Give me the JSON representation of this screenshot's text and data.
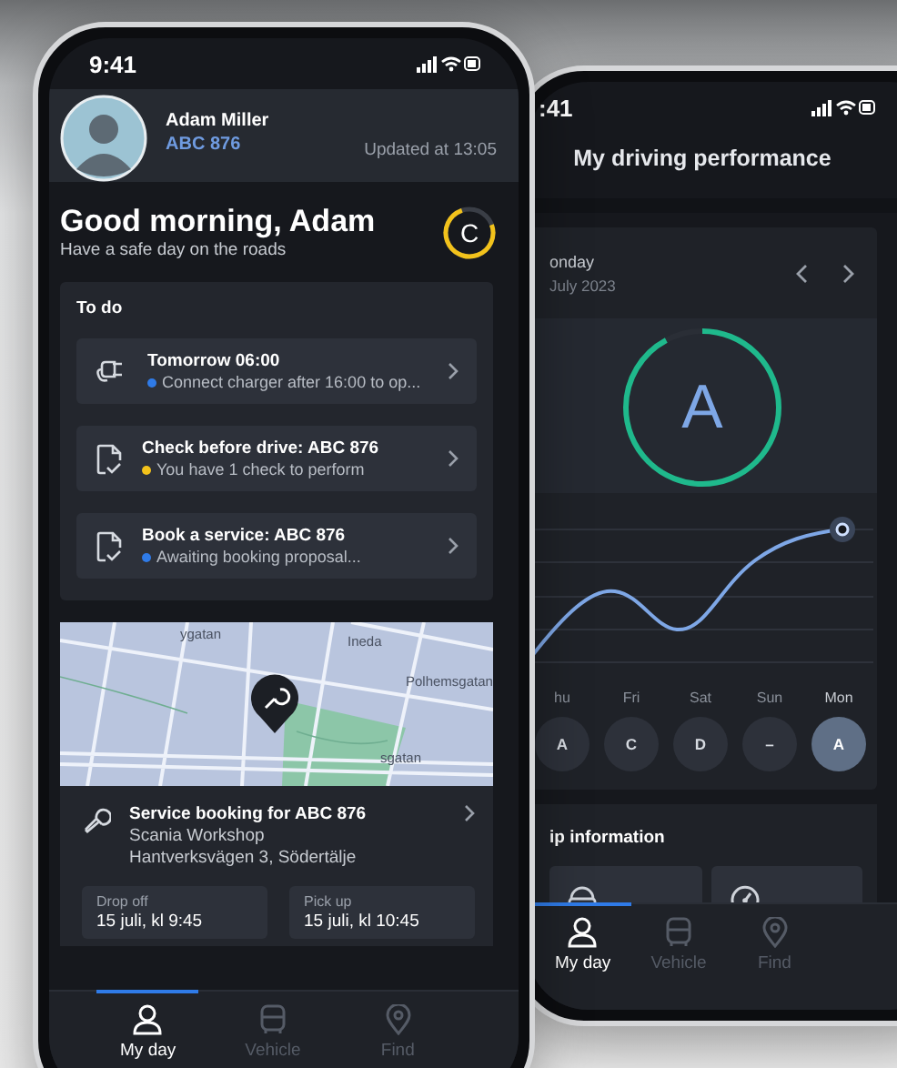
{
  "front_screen": {
    "status_time": "9:41",
    "user": {
      "name": "Adam Miller",
      "vehicle": "ABC 876",
      "updated": "Updated at 13:05"
    },
    "greeting": {
      "title": "Good morning, Adam",
      "subtitle": "Have a safe day on the roads",
      "grade": {
        "letter": "C",
        "level": 0.75
      }
    },
    "todo": {
      "title": "To do",
      "items": [
        {
          "kind": "charger",
          "title": "Tomorrow 06:00",
          "status": "Connect charger after 16:00 to op...",
          "color": "#2f7be8"
        },
        {
          "kind": "checklist",
          "title": "Check before drive: ABC 876",
          "status": "You have 1 check to perform",
          "color": "#f2c21b"
        },
        {
          "kind": "checklist",
          "title": "Book a service: ABC 876",
          "status": "Awaiting booking proposal...",
          "color": "#2f7be8"
        }
      ]
    },
    "map": {
      "street_labels": [
        "ygatan",
        "Ineda",
        "Polhemsgatan",
        "sgatan"
      ]
    },
    "booking": {
      "title": "Service booking for ABC 876",
      "workshop": "Scania Workshop",
      "address": "Hantverksvägen 3, Södertälje",
      "slots": [
        {
          "label": "Drop off",
          "value": "15 juli, kl 9:45"
        },
        {
          "label": "Pick up",
          "value": "15 juli, kl 10:45"
        }
      ]
    },
    "tabs": [
      {
        "kind": "person",
        "label": "My day",
        "selected": true
      },
      {
        "kind": "truck",
        "label": "Vehicle",
        "selected": false
      },
      {
        "kind": "pin",
        "label": "Find",
        "selected": false
      }
    ]
  },
  "back_screen": {
    "status_time": ":41",
    "title": "My driving performance",
    "date": {
      "day": "onday",
      "date": "July 2023"
    },
    "grade": {
      "letter": "A",
      "level": 0.92
    },
    "days": [
      {
        "label": "hu",
        "grade": "A",
        "selected": false
      },
      {
        "label": "Fri",
        "grade": "C",
        "selected": false
      },
      {
        "label": "Sat",
        "grade": "D",
        "selected": false
      },
      {
        "label": "Sun",
        "grade": "–",
        "selected": false
      },
      {
        "label": "Mon",
        "grade": "A",
        "selected": true
      }
    ],
    "trip": {
      "title": "ip information"
    },
    "tabs": [
      {
        "kind": "person",
        "label": "My day",
        "selected": true
      },
      {
        "kind": "truck",
        "label": "Vehicle",
        "selected": false
      },
      {
        "kind": "pin",
        "label": "Find",
        "selected": false
      }
    ]
  }
}
